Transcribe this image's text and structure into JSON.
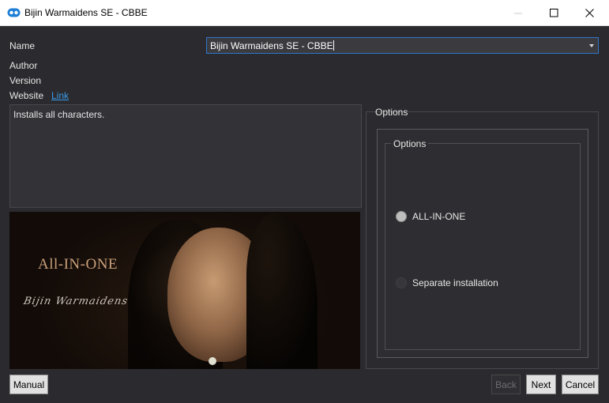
{
  "window": {
    "title": "Bijin Warmaidens SE - CBBE"
  },
  "info": {
    "name_label": "Name",
    "name_value": "Bijin Warmaidens SE - CBBE",
    "author_label": "Author",
    "version_label": "Version",
    "website_label": "Website",
    "website_link": "Link",
    "description": "Installs all characters."
  },
  "banner": {
    "title": "All-IN-ONE",
    "script": "Bijin Warmaidens"
  },
  "options": {
    "outer_label": "Options",
    "group_label": "Options",
    "items": [
      {
        "label": "ALL-IN-ONE",
        "checked": true
      },
      {
        "label": "Separate installation",
        "checked": false
      }
    ]
  },
  "buttons": {
    "manual": "Manual",
    "back": "Back",
    "next": "Next",
    "cancel": "Cancel"
  }
}
